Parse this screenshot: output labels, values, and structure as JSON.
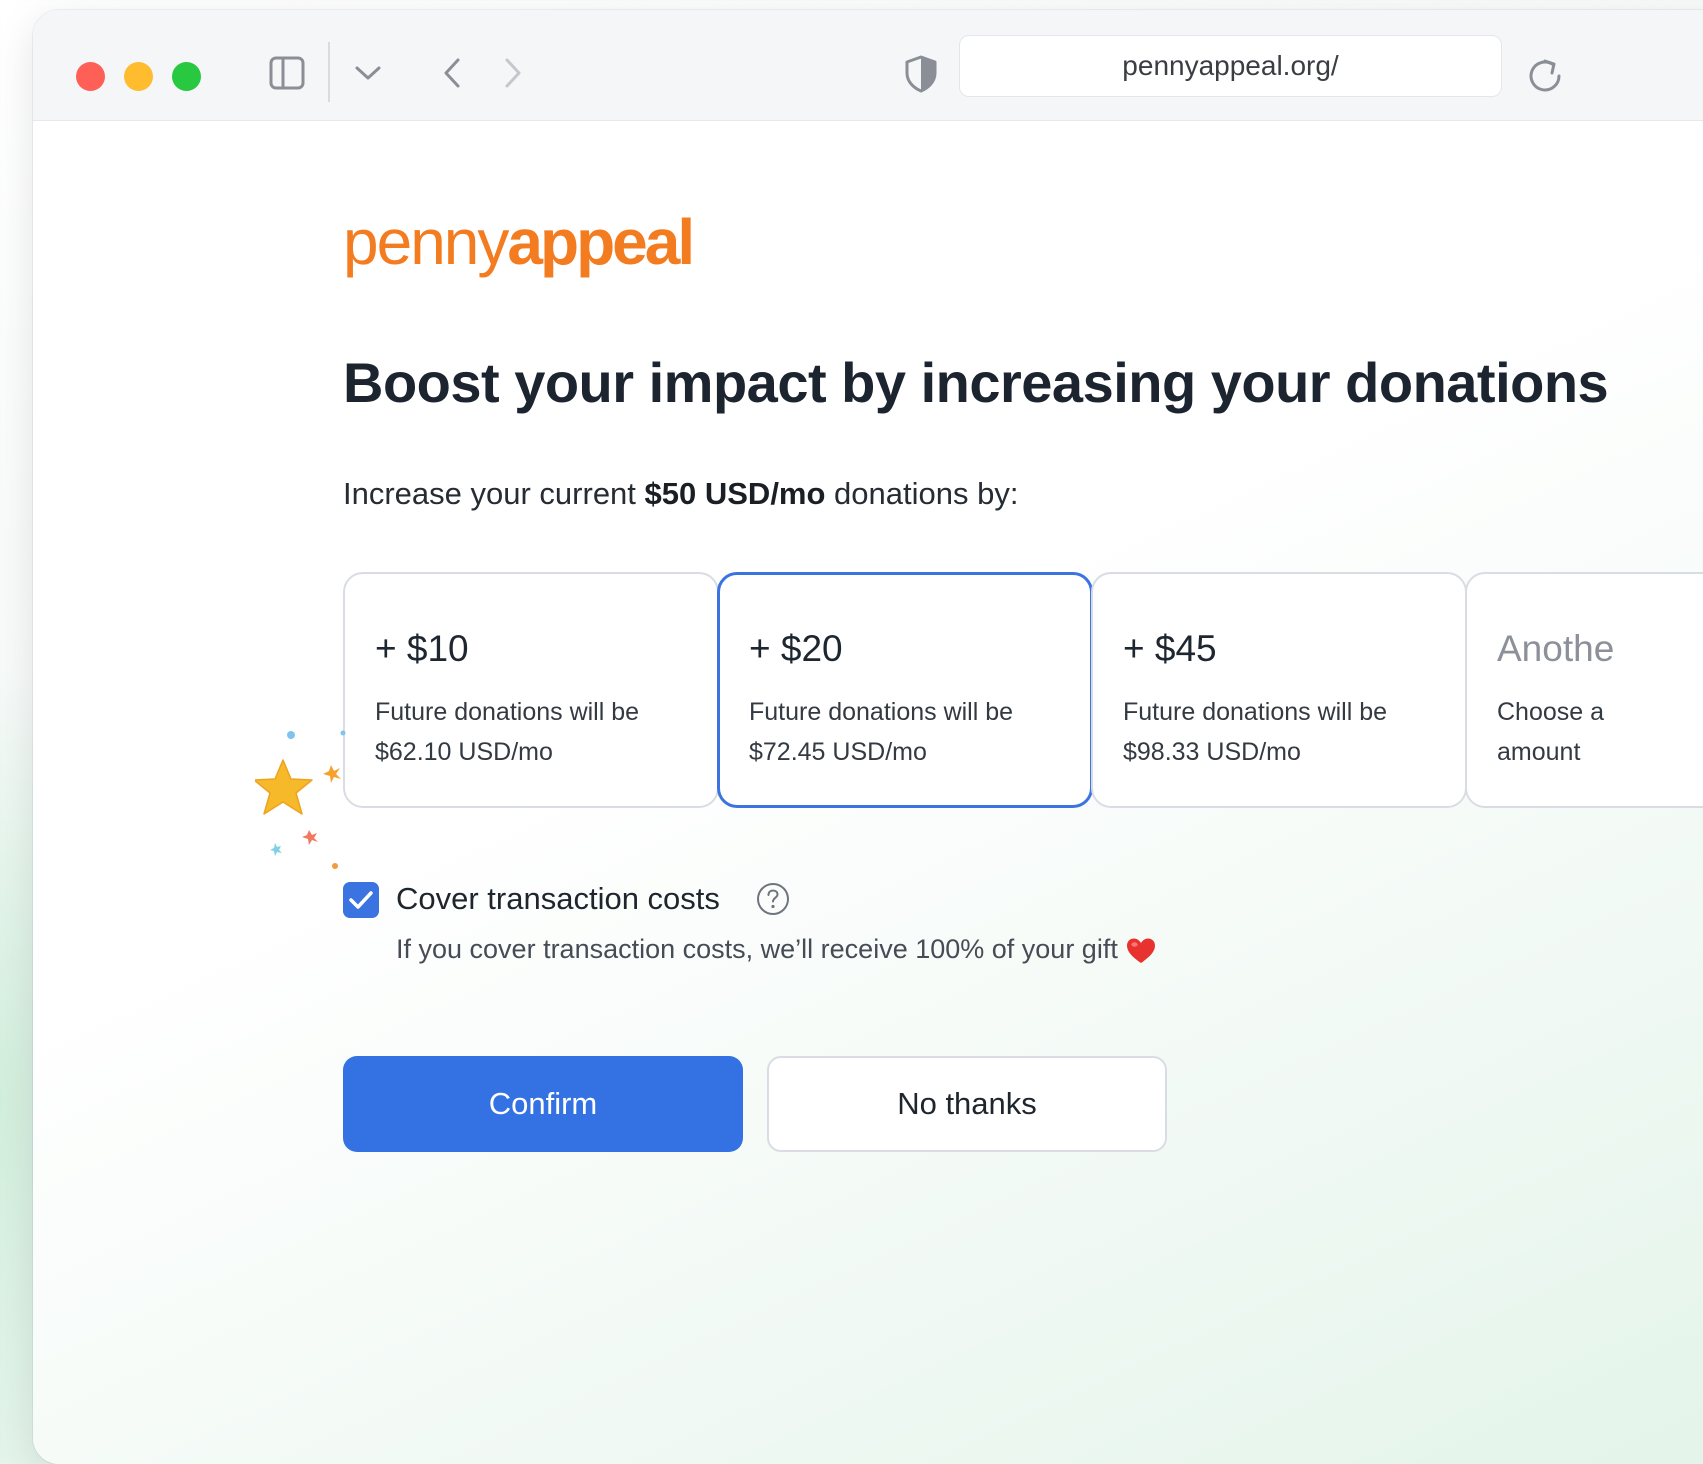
{
  "browser": {
    "url": "pennyappeal.org/",
    "window_controls": [
      "close",
      "minimize",
      "maximize"
    ],
    "toolbar_icons": [
      "sidebar-toggle-icon",
      "chevron-down-icon",
      "back-arrow-icon",
      "forward-arrow-icon",
      "shield-icon",
      "reload-icon"
    ]
  },
  "logo": {
    "light": "penny",
    "bold": "appeal",
    "color": "#f47c20"
  },
  "headline": "Boost your impact by increasing your donations",
  "subline": {
    "prefix": "Increase your current ",
    "highlight": "$50 USD/mo",
    "suffix": " donations by:"
  },
  "options": [
    {
      "amount": "+ $10",
      "line1": "Future donations will be",
      "line2": "$62.10 USD/mo",
      "selected": false
    },
    {
      "amount": "+ $20",
      "line1": "Future donations will be",
      "line2": "$72.45 USD/mo",
      "selected": true
    },
    {
      "amount": "+ $45",
      "line1": "Future donations will be",
      "line2": "$98.33 USD/mo",
      "selected": false
    },
    {
      "amount": "Anothe",
      "line1": "Choose a",
      "line2": "amount",
      "selected": false
    }
  ],
  "cover_costs": {
    "checked": true,
    "label": "Cover transaction costs",
    "note": "If you cover transaction costs, we’ll receive 100% of your gift"
  },
  "buttons": {
    "confirm": "Confirm",
    "no_thanks": "No thanks"
  },
  "colors": {
    "accent": "#3472e3",
    "selected_border": "#3b73e0",
    "heading": "#1c2430"
  }
}
